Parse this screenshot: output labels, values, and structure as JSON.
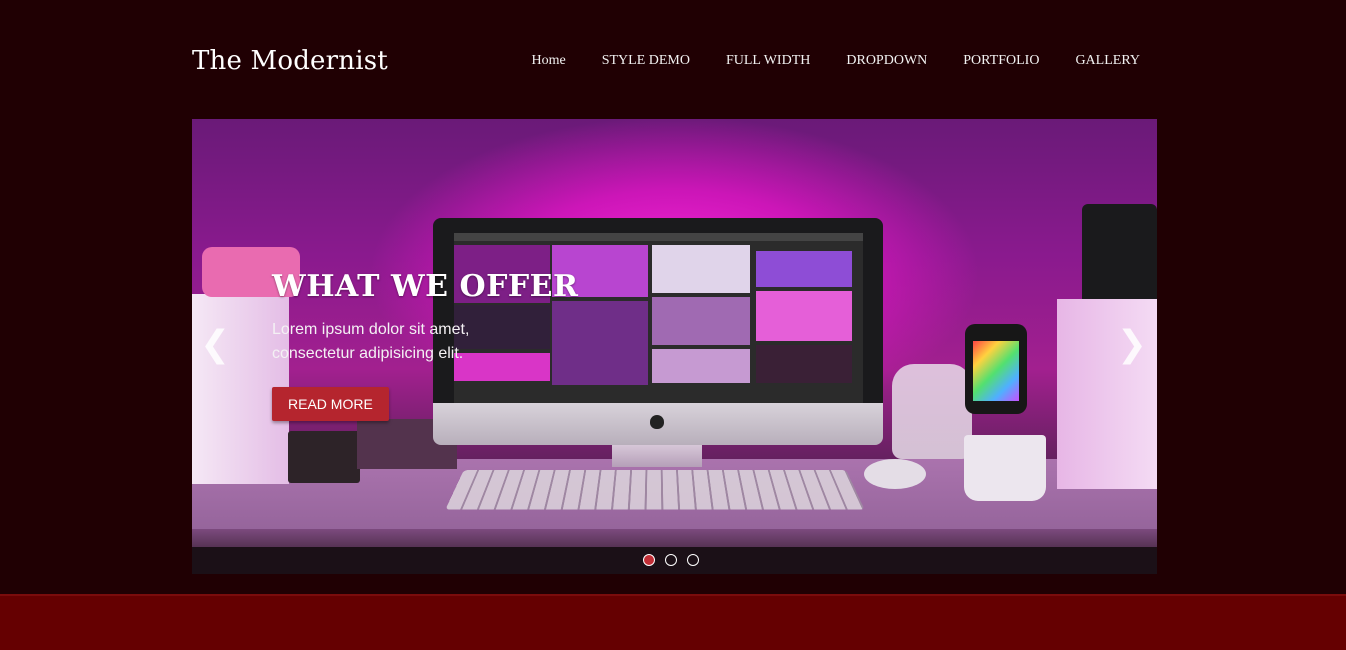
{
  "site": {
    "title": "The Modernist"
  },
  "nav": {
    "items": [
      {
        "label": "Home"
      },
      {
        "label": "STYLE DEMO"
      },
      {
        "label": "FULL WIDTH"
      },
      {
        "label": "DROPDOWN"
      },
      {
        "label": "PORTFOLIO"
      },
      {
        "label": "GALLERY"
      }
    ]
  },
  "slider": {
    "title": "WHAT WE OFFER",
    "text": "Lorem ipsum dolor sit amet, consectetur adipisicing elit.",
    "button_label": "READ MORE",
    "prev_icon": "chevron-left-icon",
    "next_icon": "chevron-right-icon",
    "prev_glyph": "❮",
    "next_glyph": "❯",
    "slide_count": 3,
    "active_slide": 1
  },
  "colors": {
    "page_background": "#200003",
    "footer_band": "#650001",
    "accent": "#b5252e"
  }
}
